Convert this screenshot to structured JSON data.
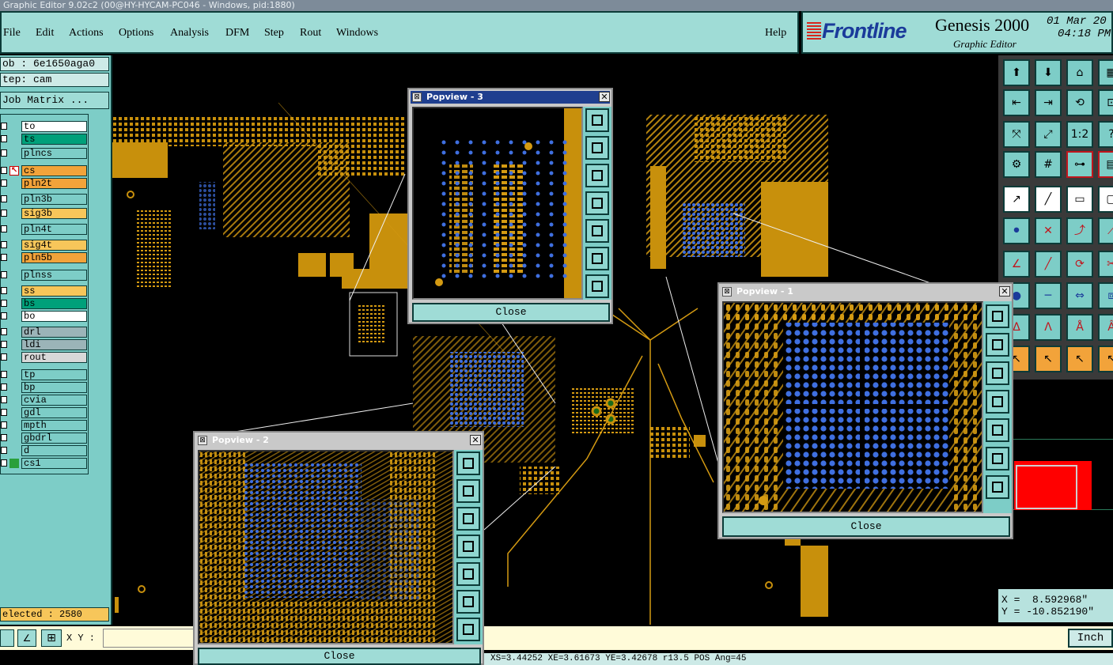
{
  "window_title": "Graphic Editor 9.02c2 (00@HY-HYCAM-PC046 - Windows, pid:1880)",
  "menu": {
    "items": [
      "File",
      "Edit",
      "Actions",
      "Options",
      "Analysis",
      "DFM",
      "Step",
      "Rout",
      "Windows"
    ],
    "help": "Help"
  },
  "brand": {
    "logo": "Frontline",
    "product": "Genesis 2000",
    "subtitle": "Graphic Editor",
    "date": "01 Mar 20",
    "time": "04:18 PM"
  },
  "job": {
    "job_label": "ob : 6e1650aga0",
    "step_label": "tep: cam",
    "matrix_button": "Job Matrix ..."
  },
  "layers": [
    {
      "name": "to",
      "color": "#ffffff",
      "icon": "none"
    },
    {
      "name": "ts",
      "color": "#00a07a",
      "icon": "none"
    },
    {
      "name": "plncs",
      "color": "#7dcdc7",
      "icon": "none"
    },
    {
      "name": "cs",
      "color": "#f2a33a",
      "icon": "work-layer-icon"
    },
    {
      "name": "pln2t",
      "color": "#f2a33a",
      "icon": "none"
    },
    {
      "name": "pln3b",
      "color": "#7dcdc7",
      "icon": "none"
    },
    {
      "name": "sig3b",
      "color": "#f7c65a",
      "icon": "none"
    },
    {
      "name": "pln4t",
      "color": "#7dcdc7",
      "icon": "none"
    },
    {
      "name": "sig4t",
      "color": "#f7c65a",
      "icon": "none"
    },
    {
      "name": "pln5b",
      "color": "#f2a33a",
      "icon": "none"
    },
    {
      "name": "plnss",
      "color": "#7dcdc7",
      "icon": "none"
    },
    {
      "name": "ss",
      "color": "#f7c65a",
      "icon": "none"
    },
    {
      "name": "bs",
      "color": "#00a07a",
      "icon": "none"
    },
    {
      "name": "bo",
      "color": "#ffffff",
      "icon": "none"
    },
    {
      "name": "drl",
      "color": "#9bb4b8",
      "icon": "none"
    },
    {
      "name": "ldi",
      "color": "#9bb4b8",
      "icon": "none"
    },
    {
      "name": "rout",
      "color": "#d8d8d8",
      "icon": "none"
    },
    {
      "name": "tp",
      "color": "#7dcdc7",
      "icon": "none"
    },
    {
      "name": "bp",
      "color": "#7dcdc7",
      "icon": "none"
    },
    {
      "name": "cvia",
      "color": "#7dcdc7",
      "icon": "none"
    },
    {
      "name": "gdl",
      "color": "#7dcdc7",
      "icon": "none"
    },
    {
      "name": "mpth",
      "color": "#7dcdc7",
      "icon": "none"
    },
    {
      "name": "gbdrl",
      "color": "#7dcdc7",
      "icon": "none"
    },
    {
      "name": "d",
      "color": "#7dcdc7",
      "icon": "none"
    },
    {
      "name": "cs1",
      "color": "#7dcdc7",
      "icon": "green-mark-icon"
    }
  ],
  "selected_label": "elected : 2580",
  "xy_label": "X Y :",
  "unit_button": "Inch",
  "coords": {
    "x": "X =  8.592968\"",
    "y": "Y = -10.852190\""
  },
  "status_text": "XS=3.44252 XE=3.61673 YE=3.42678 r13.5 POS Ang=45",
  "popups": [
    {
      "title": "Popview - 3",
      "close": "Close"
    },
    {
      "title": "Popview - 2",
      "close": "Close"
    },
    {
      "title": "Popview - 1",
      "close": "Close"
    }
  ],
  "colors": {
    "trace": "#d49a12",
    "pad": "#c8900c",
    "via": "#3f6fe0",
    "panel": "#7dcdc7",
    "title_active": "#1f3f8f"
  }
}
